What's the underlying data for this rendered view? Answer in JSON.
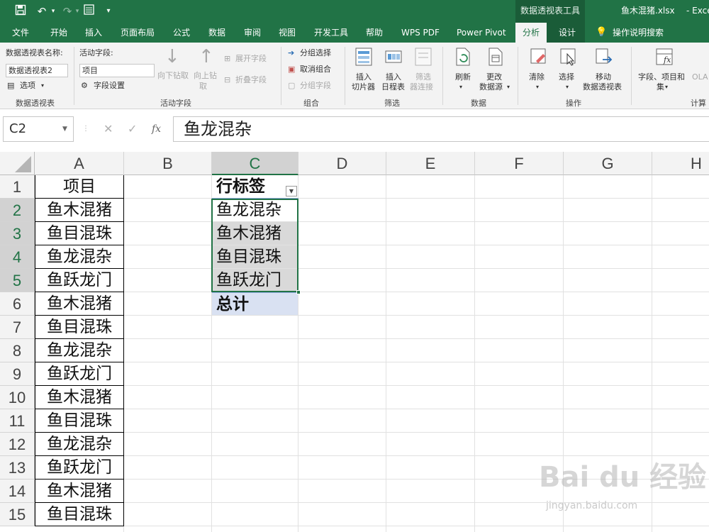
{
  "titlebar": {
    "context_tool": "数据透视表工具",
    "filename": "鱼木混猪.xlsx",
    "app": "- Excel"
  },
  "tabs": [
    "文件",
    "开始",
    "插入",
    "页面布局",
    "公式",
    "数据",
    "审阅",
    "视图",
    "开发工具",
    "帮助",
    "WPS PDF",
    "Power Pivot",
    "分析",
    "设计",
    "操作说明搜索"
  ],
  "ribbon": {
    "pivot_name_label": "数据透视表名称:",
    "pivot_name_value": "数据透视表2",
    "options": "选项",
    "group_pivot": "数据透视表",
    "active_field_label": "活动字段:",
    "active_field_value": "项目",
    "field_settings": "字段设置",
    "drill_down": "向下钻取",
    "drill_up": "向上钻",
    "drill_up2": "取",
    "expand_field": "展开字段",
    "collapse_field": "折叠字段",
    "group_active": "活动字段",
    "group_selection": "分组选择",
    "ungroup": "取消组合",
    "group_field": "分组字段",
    "group_group": "组合",
    "insert_slicer1": "插入",
    "insert_slicer2": "切片器",
    "insert_timeline1": "插入",
    "insert_timeline2": "日程表",
    "filter_conn1": "筛选",
    "filter_conn2": "器连接",
    "group_filter": "筛选",
    "refresh": "刷新",
    "change_src1": "更改",
    "change_src2": "数据源",
    "group_data": "数据",
    "clear": "清除",
    "select": "选择",
    "move1": "移动",
    "move2": "数据透视表",
    "group_actions": "操作",
    "fields1": "字段、项目和",
    "fields2": "集",
    "ola": "OLA",
    "group_calc": "计算"
  },
  "formula_bar": {
    "name_box": "C2",
    "cancel": "✕",
    "enter": "✓",
    "fx": "fx",
    "content": "鱼龙混杂"
  },
  "columns": [
    "A",
    "B",
    "C",
    "D",
    "E",
    "F",
    "G",
    "H"
  ],
  "rows": [
    "1",
    "2",
    "3",
    "4",
    "5",
    "6",
    "7",
    "8",
    "9",
    "10",
    "11",
    "12",
    "13",
    "14",
    "15"
  ],
  "colA": [
    "项目",
    "鱼木混猪",
    "鱼目混珠",
    "鱼龙混杂",
    "鱼跃龙门",
    "鱼木混猪",
    "鱼目混珠",
    "鱼龙混杂",
    "鱼跃龙门",
    "鱼木混猪",
    "鱼目混珠",
    "鱼龙混杂",
    "鱼跃龙门",
    "鱼木混猪",
    "鱼目混珠"
  ],
  "pivot": {
    "header": "行标签",
    "items": [
      "鱼龙混杂",
      "鱼木混猪",
      "鱼目混珠",
      "鱼跃龙门"
    ],
    "total": "总计"
  },
  "watermark": {
    "brand": "Bai du 经验",
    "url": "jingyan.baidu.com"
  },
  "colors": {
    "excel_green": "#217346",
    "pivot_total": "#d9e1f2"
  }
}
